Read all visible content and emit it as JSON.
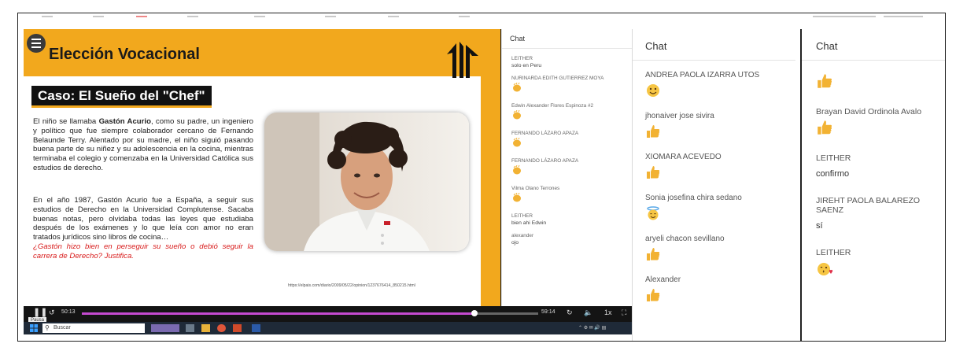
{
  "slide": {
    "title": "Elección Vocacional",
    "case_title": "Caso: El Sueño del \"Chef\"",
    "para1_pre": "El niño se llamaba ",
    "para1_bold": "Gastón Acurio",
    "para1_post": ", como su padre, un ingeniero y político que fue siempre colaborador cercano de Fernando Belaunde Terry. Alentado por su madre, el niño siguió pasando buena parte de su niñez y su adolescencia en la cocina, mientras terminaba el colegio y comenzaba en la Universidad Católica sus estudios de derecho.",
    "para2": "En el año 1987, Gastón Acurio fue a España, a seguir sus estudios de Derecho en la Universidad Complutense. Sacaba buenas notas, pero olvidaba todas las leyes que estudiaba después de los exámenes y lo que leía con amor no eran tratados jurídicos sino libros de cocina…",
    "question": "¿Gastón hizo bien en perseguir su sueño o debió seguir la carrera de Derecho? Justifica.",
    "source_url": "https://elpais.com/diario/2009/05/22/opinion/1237676414_850215.html"
  },
  "player": {
    "current_time": "50:13",
    "total_time": "59:14",
    "progress": 0.86,
    "speed": "1x",
    "play_tooltip": "Pausa"
  },
  "taskbar": {
    "search_placeholder": "Buscar"
  },
  "chat1": {
    "title": "Chat",
    "messages": [
      {
        "name": "LEITHER",
        "text": "solo en Peru"
      },
      {
        "name": "NURINARDA EDITH GUTIERREZ MOYA",
        "icon": "clap-icon"
      },
      {
        "name": "Edwin Alexander Flores Espinoza #2",
        "icon": "clap-icon"
      },
      {
        "name": "FERNANDO LÁZARO APAZA",
        "icon": "clap-icon"
      },
      {
        "name": "FERNANDO LÁZARO APAZA",
        "icon": "clap-icon"
      },
      {
        "name": "Vilma Olano Terrones",
        "icon": "clap-icon"
      },
      {
        "name": "LEITHER",
        "text": "bien ahi Edwin"
      },
      {
        "name": "alexander",
        "text": "ojo"
      }
    ]
  },
  "chat2": {
    "title": "Chat",
    "messages": [
      {
        "name": "ANDREA PAOLA IZARRA UTOS",
        "icon": "smile-icon"
      },
      {
        "name": "jhonaiver jose sivira",
        "icon": "thumbs-up-icon"
      },
      {
        "name": "XIOMARA ACEVEDO",
        "icon": "thumbs-up-icon"
      },
      {
        "name": "Sonia josefina chira sedano",
        "icon": "halo-face-icon"
      },
      {
        "name": "aryeli chacon sevillano",
        "icon": "thumbs-up-icon"
      },
      {
        "name": "Alexander",
        "icon": "thumbs-up-icon"
      }
    ]
  },
  "chat3": {
    "title": "Chat",
    "messages": [
      {
        "name": "",
        "icon": "thumbs-up-icon"
      },
      {
        "name": "Brayan David Ordinola Avalo",
        "icon": "thumbs-up-icon"
      },
      {
        "name": "LEITHER",
        "text": "confirmo"
      },
      {
        "name": "JIREHT PAOLA BALAREZO SAENZ",
        "text": "sí"
      },
      {
        "name": "LEITHER",
        "icon": "kiss-face-icon"
      }
    ]
  }
}
